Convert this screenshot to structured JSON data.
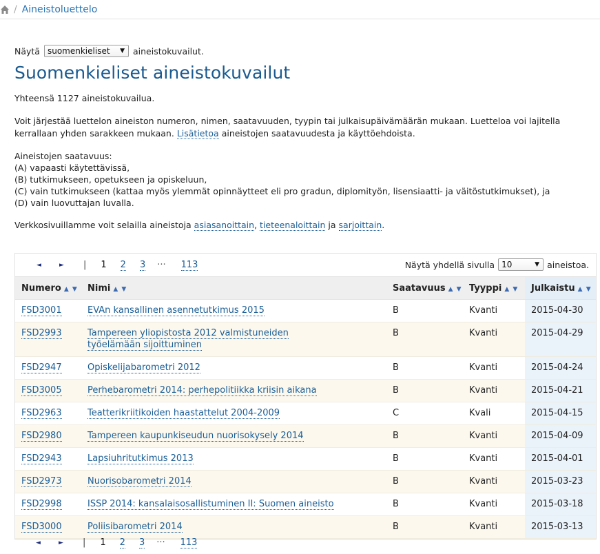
{
  "breadcrumb": {
    "home_icon": "home-icon",
    "separator": "/",
    "current": "Aineistoluettelo"
  },
  "filter": {
    "prefix": "Näytä",
    "selected": "suomenkieliset",
    "suffix": "aineistokuvailut."
  },
  "title": "Suomenkieliset aineistokuvailut",
  "total_text": "Yhteensä 1127 aineistokuvailua.",
  "sort_info": {
    "before": "Voit järjestää luettelon aineiston numeron, nimen, saatavuuden, tyypin tai julkaisupäivämäärän mukaan. Luetteloa voi lajitella kerrallaan yhden sarakkeen mukaan.",
    "link": "Lisätietoa",
    "after": "aineistojen saatavuudesta ja käyttöehdoista."
  },
  "availability": {
    "heading": "Aineistojen saatavuus:",
    "items": [
      "(A) vapaasti käytettävissä,",
      "(B) tutkimukseen, opetukseen ja opiskeluun,",
      "(C) vain tutkimukseen (kattaa myös ylemmät opinnäytteet eli pro gradun, diplomityön, lisensiaatti- ja väitöstutkimukset), ja",
      "(D) vain luovuttajan luvalla."
    ]
  },
  "browse": {
    "before": "Verkkosivuillamme voit selailla aineistoja",
    "link1": "asiasanoittain",
    "sep1": ",",
    "link2": "tieteenaloittain",
    "sep2": "ja",
    "link3": "sarjoittain",
    "end": "."
  },
  "pager": {
    "prev_icon": "◄",
    "next_icon": "►",
    "bar": "|",
    "current": "1",
    "page2": "2",
    "page3": "3",
    "ellipsis": "···",
    "last": "113"
  },
  "per_page": {
    "before": "Näytä yhdellä sivulla",
    "selected": "10",
    "after": "aineistoa."
  },
  "columns": {
    "number": "Numero",
    "name": "Nimi",
    "availability": "Saatavuus",
    "type": "Tyyppi",
    "published": "Julkaistu",
    "sort_arrows": "▲ ▼"
  },
  "rows": [
    {
      "id": "FSD3001",
      "name": "EVAn kansallinen asennetutkimus 2015",
      "avail": "B",
      "type": "Kvanti",
      "date": "2015-04-30"
    },
    {
      "id": "FSD2993",
      "name": "Tampereen yliopistosta 2012 valmistuneiden työelämään sijoittuminen",
      "avail": "B",
      "type": "Kvanti",
      "date": "2015-04-29"
    },
    {
      "id": "FSD2947",
      "name": "Opiskelijabarometri 2012",
      "avail": "B",
      "type": "Kvanti",
      "date": "2015-04-24"
    },
    {
      "id": "FSD3005",
      "name": "Perhebarometri 2014: perhepolitiikka kriisin aikana",
      "avail": "B",
      "type": "Kvanti",
      "date": "2015-04-21"
    },
    {
      "id": "FSD2963",
      "name": "Teatterikriitikoiden haastattelut 2004-2009",
      "avail": "C",
      "type": "Kvali",
      "date": "2015-04-15"
    },
    {
      "id": "FSD2980",
      "name": "Tampereen kaupunkiseudun nuorisokysely 2014",
      "avail": "B",
      "type": "Kvanti",
      "date": "2015-04-09"
    },
    {
      "id": "FSD2943",
      "name": "Lapsiuhritutkimus 2013",
      "avail": "B",
      "type": "Kvanti",
      "date": "2015-04-01"
    },
    {
      "id": "FSD2973",
      "name": "Nuorisobarometri 2014",
      "avail": "B",
      "type": "Kvanti",
      "date": "2015-03-23"
    },
    {
      "id": "FSD2998",
      "name": "ISSP 2014: kansalaisosallistuminen II: Suomen aineisto",
      "avail": "B",
      "type": "Kvanti",
      "date": "2015-03-18"
    },
    {
      "id": "FSD3000",
      "name": "Poliisibarometri 2014",
      "avail": "B",
      "type": "Kvanti",
      "date": "2015-03-13"
    }
  ]
}
